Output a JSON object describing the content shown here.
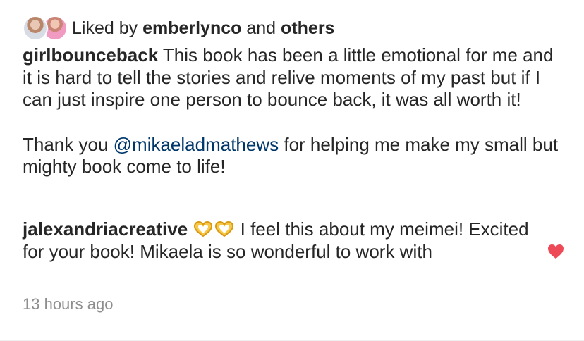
{
  "likes": {
    "prefix": "Liked by",
    "first_user": "emberlynco",
    "connector": "and",
    "others": "others"
  },
  "caption": {
    "username": "girlbounceback",
    "paragraph1": "This book has been a little emotional for me and it is hard to tell the stories and relive moments of my past but if I can just inspire one person to bounce back, it was all worth it!",
    "paragraph2_start": "Thank you",
    "mention": "@mikaeladmathews",
    "paragraph2_end": "for helping me make my small but mighty book come to life!"
  },
  "reply": {
    "username": "jalexandriacreative",
    "emojis": [
      "heart-hands-emoji",
      "heart-hands-emoji"
    ],
    "text": "I feel this about my meimei! Excited for your book! Mikaela is so wonderful  to work with",
    "like_icon": "heart-icon",
    "like_color": "#ed4956"
  },
  "timestamp": "13 hours ago",
  "colors": {
    "text": "#262626",
    "mention": "#00376b",
    "meta": "#8e8e8e"
  }
}
